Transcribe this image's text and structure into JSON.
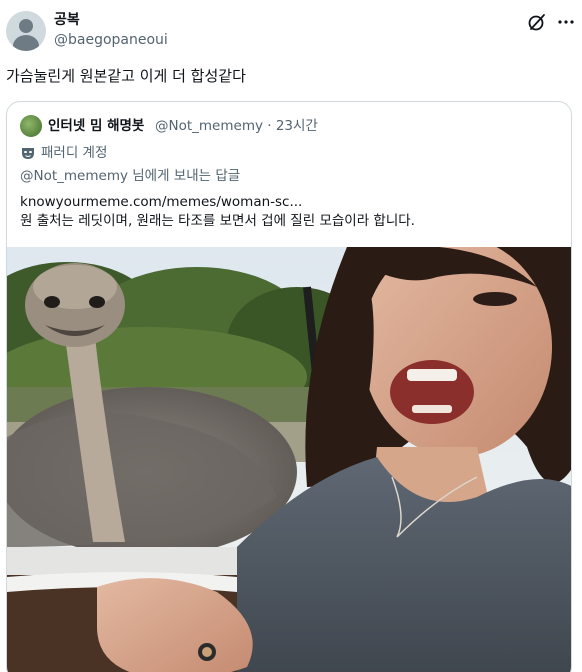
{
  "tweet": {
    "display_name": "공복",
    "handle": "@baegopaneoui",
    "text": "가슴눌린게 원본같고 이게 더 합성같다",
    "icons": {
      "grok": "grok-icon",
      "more": "more-icon",
      "avatar": "default-avatar-icon"
    }
  },
  "quote": {
    "display_name": "인터넷 밈 해명봇",
    "handle_time": "@Not_mememy · 23시간",
    "account_label": "패러디 계정",
    "account_label_icon": "mask-icon",
    "reply_to": "@Not_mememy 님에게 보내는 답글",
    "link": "knowyourmeme.com/memes/woman-sc...",
    "body": "원 출처는 레딧이며, 원래는 타조를 보면서 겁에 질린 모습이라 합니다.",
    "image_alt": "ostrich-and-screaming-woman-photo"
  }
}
